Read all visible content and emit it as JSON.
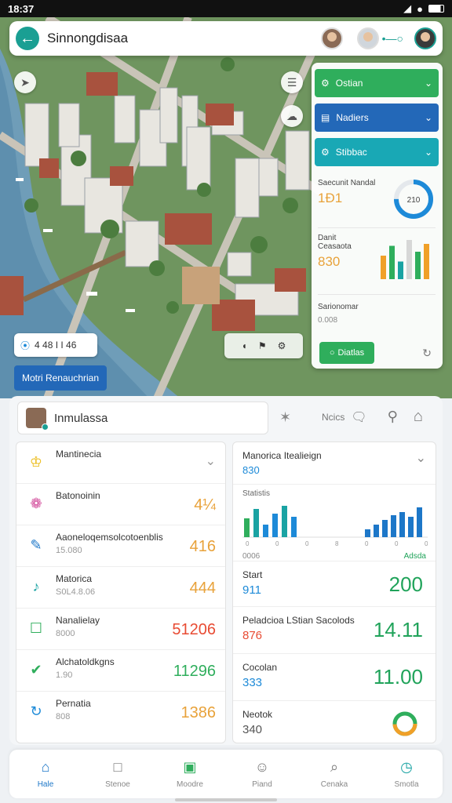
{
  "status": {
    "time": "18:37"
  },
  "header": {
    "title": "Sinnongdisaa"
  },
  "map_overlay": {
    "info_pill": "4 48 I I 46",
    "action_button": "Motri Renauchrian"
  },
  "panel": {
    "items": [
      {
        "label": "Ostian",
        "color": "#2fae5c",
        "icon": "gear-icon"
      },
      {
        "label": "Nadiers",
        "color": "#2368b8",
        "icon": "calendar-icon"
      },
      {
        "label": "Stibbac",
        "color": "#19a8b5",
        "icon": "settings-icon"
      }
    ],
    "card1": {
      "label": "Saecunit Nandal",
      "value": "1Ð1",
      "donut_value": "210",
      "donut_fraction": 0.75
    },
    "card2": {
      "label": "Danit Ceasaota",
      "value": "830",
      "bars": [
        60,
        85,
        45,
        100,
        70,
        90
      ]
    },
    "card3": {
      "label": "Sarionomar",
      "sub": "0.008"
    },
    "button": "Diatlas"
  },
  "search": {
    "value": "Inmulassa"
  },
  "toprow": {
    "label": "Ncics"
  },
  "list": [
    {
      "title": "Mantinecia",
      "sub": "",
      "value": "",
      "icon": "trophy-icon",
      "color": "#e9b400"
    },
    {
      "title": "Batonoinin",
      "sub": "",
      "value": "4¼",
      "icon": "brain-icon",
      "color": "#d24b9a"
    },
    {
      "title": "Aaoneloqemsolcotoenblis",
      "sub": "15.080",
      "value": "416",
      "icon": "edit-icon",
      "color": "#1d77c8"
    },
    {
      "title": "Matorica",
      "sub": "S0L4.8.06",
      "value": "444",
      "icon": "music-icon",
      "color": "#1aa3a3"
    },
    {
      "title": "Nanalielay",
      "sub": "8000",
      "value": "51206",
      "icon": "inbox-icon",
      "color": "#2fae5c"
    },
    {
      "title": "Alchatoldkgns",
      "sub": "1.90",
      "value": "11296",
      "icon": "check-icon",
      "color": "#2fae5c"
    },
    {
      "title": "Pernatia",
      "sub": "808",
      "value": "1386",
      "icon": "refresh-icon",
      "color": "#1d8ad8"
    }
  ],
  "list_value_colors": [
    "#e8a23a",
    "#e8a23a",
    "#e8a23a",
    "#e8a23a",
    "#e84b33",
    "#2fae5c",
    "#e8a23a"
  ],
  "rlist": {
    "head": {
      "title": "Manorica Itealieign",
      "sub": "830"
    },
    "chart": {
      "title": "Statistis",
      "left_bars": [
        60,
        90,
        40,
        75,
        100,
        65
      ],
      "right_bars": [
        25,
        40,
        55,
        70,
        80,
        65,
        95
      ],
      "axis_left": "0",
      "axis_labels": [
        "0",
        "0",
        "0",
        "8",
        "0",
        "0",
        "0"
      ],
      "footer_left": "0006",
      "footer_right": "Adsda"
    },
    "rows": [
      {
        "title": "Start",
        "sub": "911",
        "value": "200",
        "sub_color": "#1d8ad8",
        "value_color": "#20a35a"
      },
      {
        "title": "Peladcioa LStian Sacolods",
        "sub": "876",
        "value": "14.11",
        "sub_color": "#e84b33",
        "value_color": "#20a35a"
      },
      {
        "title": "Cocolan",
        "sub": "333",
        "value": "11.00",
        "sub_color": "#1d8ad8",
        "value_color": "#20a35a"
      },
      {
        "title": "Neotok",
        "sub": "340",
        "value": "",
        "sub_color": "#555",
        "value_color": "#20a35a"
      }
    ]
  },
  "nav": [
    {
      "label": "Hale",
      "icon": "home-icon",
      "active": true
    },
    {
      "label": "Stenoe",
      "icon": "square-icon",
      "active": false
    },
    {
      "label": "Moodre",
      "icon": "tag-icon",
      "active": false
    },
    {
      "label": "Piand",
      "icon": "people-icon",
      "active": false
    },
    {
      "label": "Cenaka",
      "icon": "search-icon",
      "active": false
    },
    {
      "label": "Smotla",
      "icon": "clock-icon",
      "active": false
    }
  ]
}
